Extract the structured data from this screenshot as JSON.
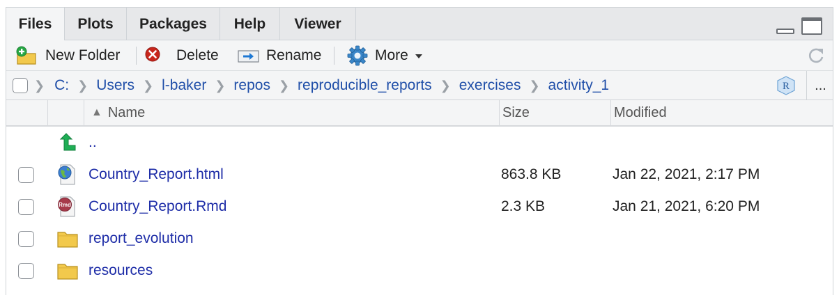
{
  "tabs": [
    {
      "label": "Files",
      "active": true
    },
    {
      "label": "Plots",
      "active": false
    },
    {
      "label": "Packages",
      "active": false
    },
    {
      "label": "Help",
      "active": false
    },
    {
      "label": "Viewer",
      "active": false
    }
  ],
  "toolbar": {
    "new_folder": "New Folder",
    "delete": "Delete",
    "rename": "Rename",
    "more": "More"
  },
  "breadcrumb": [
    "C:",
    "Users",
    "l-baker",
    "repos",
    "reproducible_reports",
    "exercises",
    "activity_1"
  ],
  "breadcrumb_more": "...",
  "columns": {
    "sort_indicator": "▲",
    "name": "Name",
    "size": "Size",
    "modified": "Modified"
  },
  "rows": [
    {
      "name": "..",
      "size": "",
      "modified": "",
      "icon": "up-arrow-icon"
    },
    {
      "name": "Country_Report.html",
      "size": "863.8 KB",
      "modified": "Jan 22, 2021, 2:17 PM",
      "icon": "html-file-icon"
    },
    {
      "name": "Country_Report.Rmd",
      "size": "2.3 KB",
      "modified": "Jan 21, 2021, 6:20 PM",
      "icon": "rmd-file-icon"
    },
    {
      "name": "report_evolution",
      "size": "",
      "modified": "",
      "icon": "folder-icon"
    },
    {
      "name": "resources",
      "size": "",
      "modified": "",
      "icon": "folder-icon"
    }
  ],
  "icon_labels": {
    "rmd": "Rmd",
    "rproj": "R"
  },
  "colors": {
    "link": "#1f2ea8",
    "breadcrumb": "#1f4ea8",
    "tab_bg": "#e7e8ea",
    "toolbar_bg": "#f4f5f6",
    "up_arrow": "#1fae55",
    "delete_red": "#c8261c",
    "folder": "#f2c94c"
  }
}
